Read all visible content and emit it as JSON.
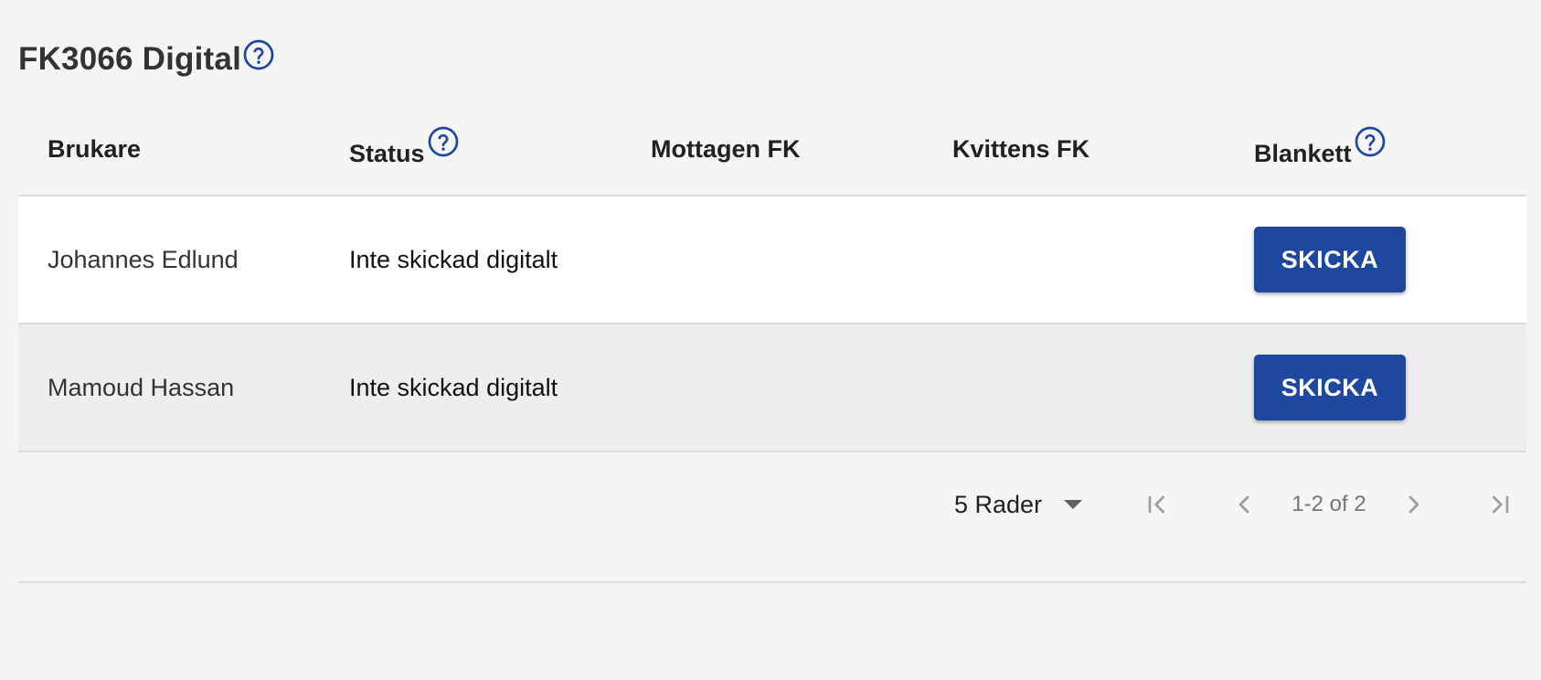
{
  "page": {
    "title": "FK3066 Digital"
  },
  "table": {
    "columns": [
      {
        "label": "Brukare",
        "help": false
      },
      {
        "label": "Status",
        "help": true
      },
      {
        "label": "Mottagen FK",
        "help": false
      },
      {
        "label": "Kvittens FK",
        "help": false
      },
      {
        "label": "Blankett",
        "help": true
      }
    ],
    "rows": [
      {
        "brukare": "Johannes Edlund",
        "status": "Inte skickad digitalt",
        "mottagen_fk": "",
        "kvittens_fk": "",
        "action_label": "SKICKA"
      },
      {
        "brukare": "Mamoud Hassan",
        "status": "Inte skickad digitalt",
        "mottagen_fk": "",
        "kvittens_fk": "",
        "action_label": "SKICKA"
      }
    ]
  },
  "pagination": {
    "rows_per_page": "5 Rader",
    "range": "1-2 of 2"
  },
  "icons": {
    "help": "help-circle-icon",
    "dropdown": "caret-down-icon",
    "first": "first-page-icon",
    "prev": "chevron-left-icon",
    "next": "chevron-right-icon",
    "last": "last-page-icon"
  },
  "colors": {
    "background": "#f5f5f5",
    "accent": "#1e48a0",
    "row_alt": "#eeeeee",
    "row": "#ffffff",
    "divider": "#dcdcdc",
    "muted_icon": "#9e9e9e"
  }
}
